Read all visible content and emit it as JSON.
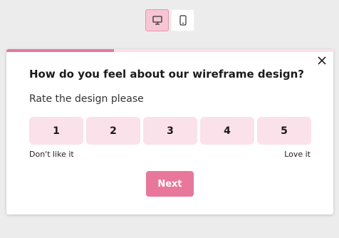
{
  "device_toggle": {
    "desktop_icon": "desktop-monitor-icon",
    "mobile_icon": "mobile-phone-icon",
    "selected": "desktop"
  },
  "survey": {
    "progress": 0.33,
    "question": "How do you feel about our wireframe design?",
    "subtitle": "Rate the design please",
    "options": [
      "1",
      "2",
      "3",
      "4",
      "5"
    ],
    "low_label": "Don't like it",
    "high_label": "Love it",
    "next_label": "Next",
    "close_icon": "close-icon"
  },
  "colors": {
    "accent": "#e8779c",
    "accent_light": "#fbe1ea",
    "background": "#ececec"
  }
}
